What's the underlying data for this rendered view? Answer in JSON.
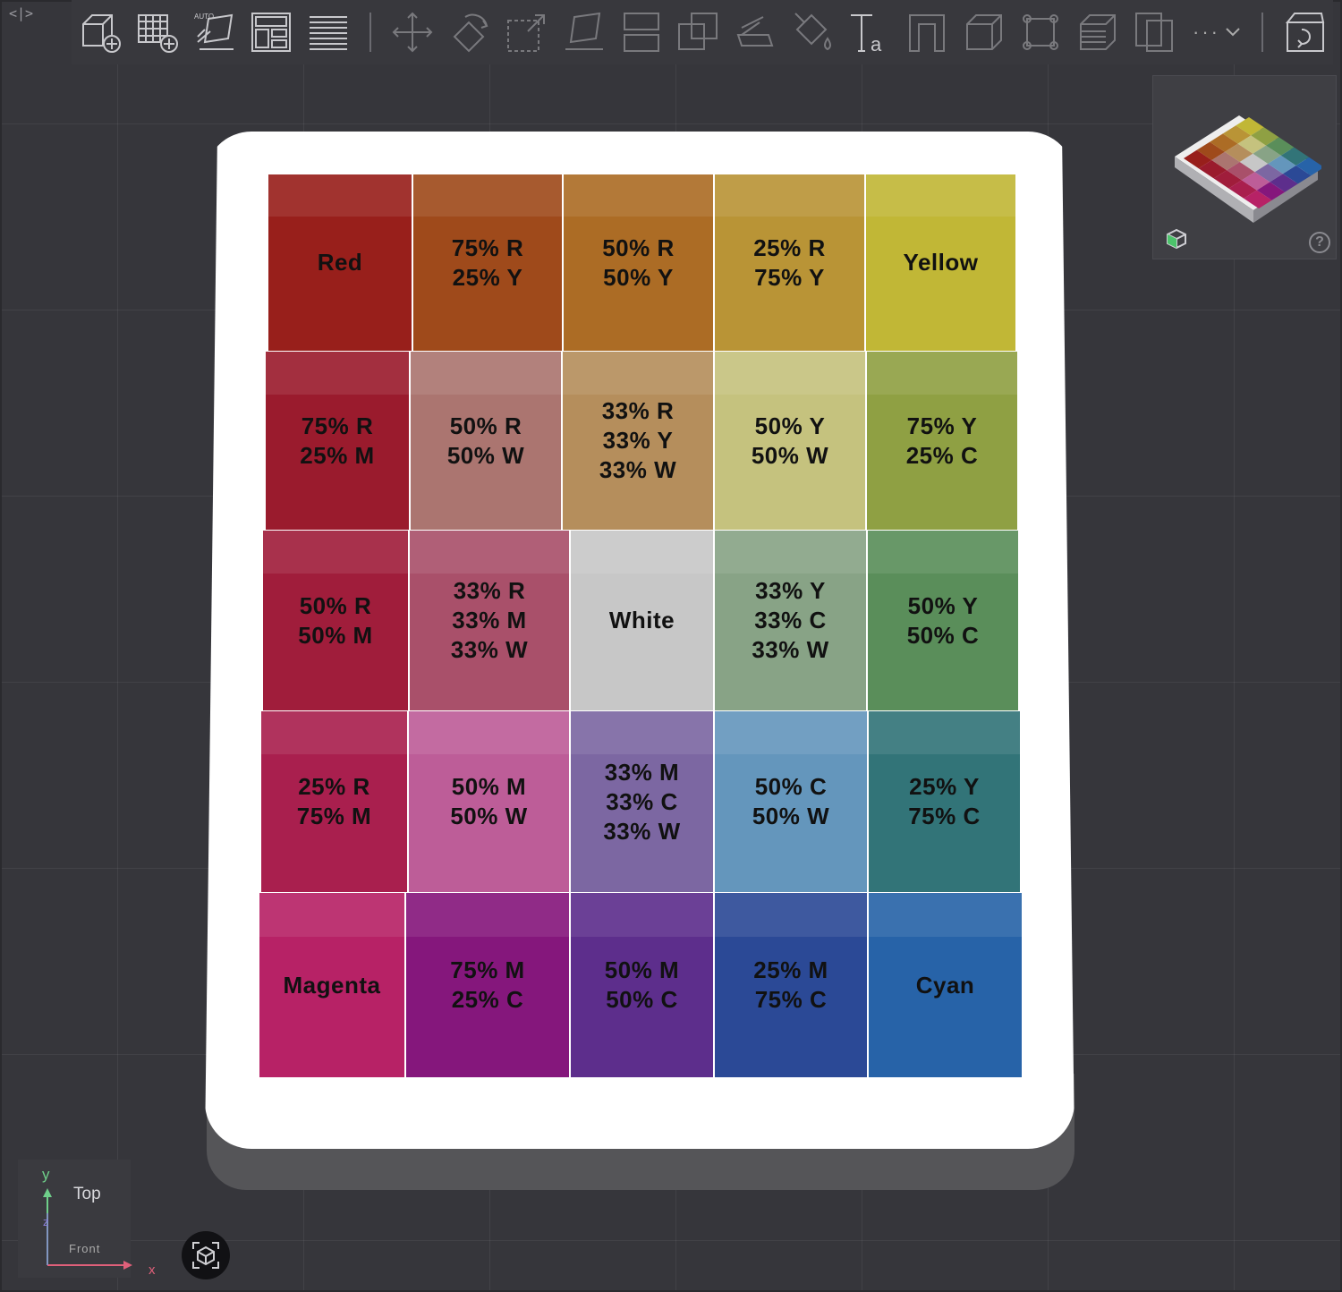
{
  "toolbar": {
    "primary_tools": [
      {
        "name": "add-box-tool-icon"
      },
      {
        "name": "add-grid-tool-icon"
      },
      {
        "name": "auto-arrange-tool-icon",
        "badge": "AUTO"
      },
      {
        "name": "layout-tool-icon"
      },
      {
        "name": "lines-tool-icon"
      }
    ],
    "secondary_tools": [
      {
        "name": "move-tool-icon"
      },
      {
        "name": "rotate-tool-icon"
      },
      {
        "name": "scale-tool-icon"
      },
      {
        "name": "place-on-face-tool-icon"
      },
      {
        "name": "split-tool-icon"
      },
      {
        "name": "boolean-tool-icon"
      },
      {
        "name": "cut-tool-icon"
      },
      {
        "name": "paint-tool-icon"
      },
      {
        "name": "text-tool-icon",
        "glyph": "Ta"
      },
      {
        "name": "support-tool-icon"
      },
      {
        "name": "measure-box-tool-icon"
      },
      {
        "name": "frame-tool-icon"
      },
      {
        "name": "layers-tool-icon"
      },
      {
        "name": "duplicate-tool-icon"
      }
    ],
    "more_label": "···",
    "end_tool": {
      "name": "assembly-tool-icon"
    }
  },
  "swatch_grid": {
    "rows": [
      [
        {
          "label": "Red",
          "color": "#981f1b"
        },
        {
          "label": "75% R\n25% Y",
          "color": "#9f4a1b"
        },
        {
          "label": "50% R\n50% Y",
          "color": "#ac6c25"
        },
        {
          "label": "25% R\n75% Y",
          "color": "#b99436"
        },
        {
          "label": "Yellow",
          "color": "#c1b736"
        }
      ],
      [
        {
          "label": "75% R\n25% M",
          "color": "#9a1b2d"
        },
        {
          "label": "50% R\n50% W",
          "color": "#ab7570"
        },
        {
          "label": "33% R\n33% Y\n33% W",
          "color": "#b58e5c"
        },
        {
          "label": "50% Y\n50% W",
          "color": "#c5c27e"
        },
        {
          "label": "75% Y\n25% C",
          "color": "#8fa043"
        }
      ],
      [
        {
          "label": "50% R\n50% M",
          "color": "#a01d3b"
        },
        {
          "label": "33% R\n33% M\n33% W",
          "color": "#a9506a"
        },
        {
          "label": "White",
          "color": "#c7c7c7"
        },
        {
          "label": "33% Y\n33% C\n33% W",
          "color": "#88a386"
        },
        {
          "label": "50% Y\n50% C",
          "color": "#5a8e5a"
        }
      ],
      [
        {
          "label": "25% R\n75% M",
          "color": "#a91f4e"
        },
        {
          "label": "50% M\n50% W",
          "color": "#bd5d98"
        },
        {
          "label": "33% M\n33% C\n33% W",
          "color": "#7c67a2"
        },
        {
          "label": "50% C\n50% W",
          "color": "#6496bc"
        },
        {
          "label": "25% Y\n75% C",
          "color": "#327478"
        }
      ],
      [
        {
          "label": "Magenta",
          "color": "#b72266"
        },
        {
          "label": "75% M\n25% C",
          "color": "#85177c"
        },
        {
          "label": "50% M\n50% C",
          "color": "#5d2e8c"
        },
        {
          "label": "25% M\n75% C",
          "color": "#2b4996"
        },
        {
          "label": "Cyan",
          "color": "#2763a8"
        }
      ]
    ]
  },
  "nav_preview": {
    "help_label": "?"
  },
  "axis_indicator": {
    "y_label": "y",
    "z_label": "z",
    "x_label": "x",
    "view_label": "Top",
    "sub_view_label": "Front"
  },
  "colors": {
    "background": "#36363b",
    "toolbar": "#38383d",
    "plate": "#ffffff",
    "plate_side": "#555558",
    "axis_y": "#6fcf8a",
    "axis_z": "#8a7fd8",
    "axis_x": "#e0607a"
  }
}
